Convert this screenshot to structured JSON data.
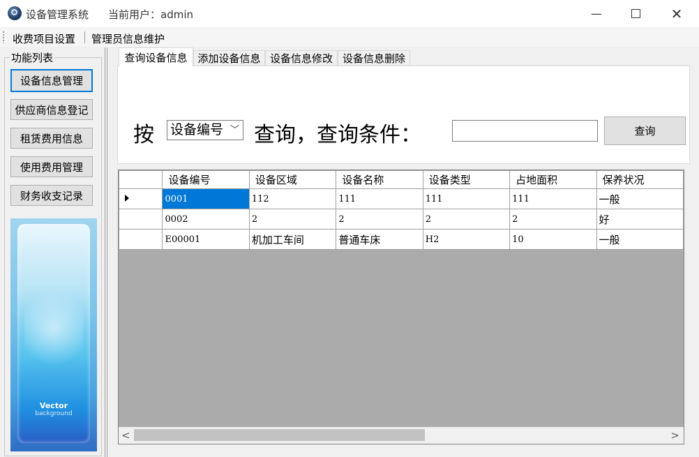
{
  "window": {
    "title": "设备管理系统",
    "current_user": "当前用户：admin",
    "minimize_glyph": "—",
    "close_glyph": "✕"
  },
  "menu": {
    "items": [
      "收费项目设置",
      "管理员信息维护"
    ]
  },
  "sidebar": {
    "group_title": "功能列表",
    "buttons": [
      "设备信息管理",
      "供应商信息登记",
      "租赁费用信息",
      "使用费用管理",
      "财务收支记录"
    ],
    "image_text": [
      "Vector",
      "background"
    ]
  },
  "tabs": [
    "查询设备信息",
    "添加设备信息",
    "设备信息修改",
    "设备信息删除"
  ],
  "query": {
    "by_label": "按",
    "field_select_value": "设备编号",
    "condition_label": "查询，查询条件：",
    "condition_value": "",
    "button_label": "查询"
  },
  "grid": {
    "columns": [
      "设备编号",
      "设备区域",
      "设备名称",
      "设备类型",
      "占地面积",
      "保养状况"
    ],
    "rows": [
      [
        "0001",
        "112",
        "111",
        "111",
        "111",
        "一般"
      ],
      [
        "0002",
        "2",
        "2",
        "2",
        "2",
        "好"
      ],
      [
        "E00001",
        "机加工车间",
        "普通车床",
        "H2",
        "10",
        "一般"
      ]
    ]
  },
  "scrollbar": {
    "left_glyph": "<",
    "right_glyph": ">"
  }
}
